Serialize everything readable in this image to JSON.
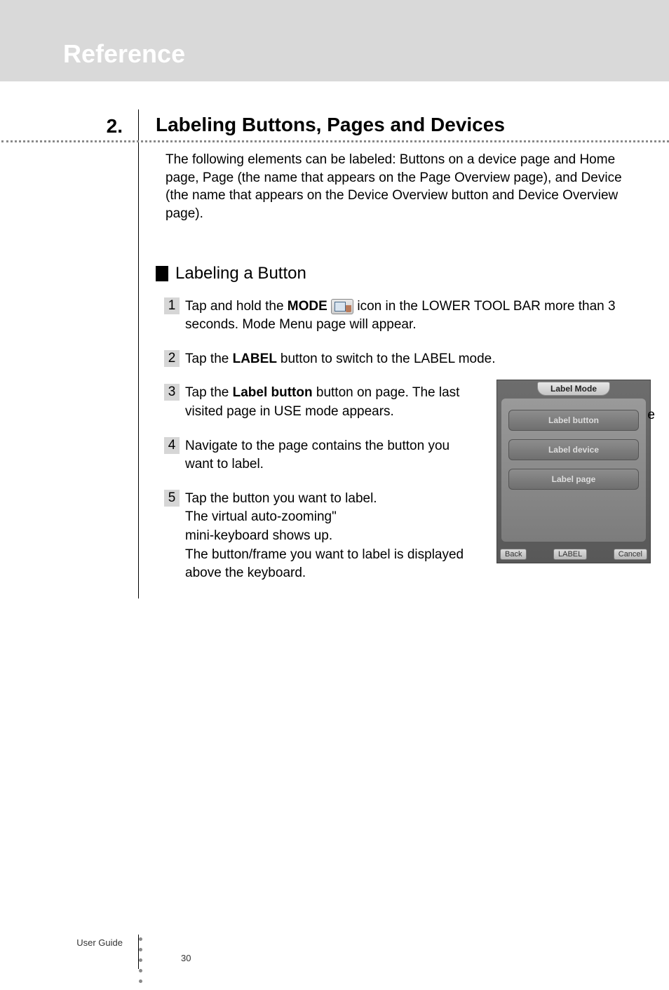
{
  "header": {
    "title": "Reference"
  },
  "section": {
    "number": "2.",
    "heading": "Labeling Buttons, Pages and Devices",
    "intro": "The following elements can be labeled: Buttons on a device page and Home page, Page (the name that appears on the Page Overview page), and Device (the name that appears on the Device Overview button and Device Overview page).",
    "subsection_title": "Labeling a Button",
    "steps": {
      "1": {
        "prefix": "Tap and hold the ",
        "bold": "MODE",
        "suffix": " icon in the LOWER TOOL BAR more than 3 seconds. Mode Menu page will appear."
      },
      "2": {
        "prefix": "Tap the ",
        "bold": " LABEL ",
        "suffix": " button to switch to the LABEL mode."
      },
      "3": {
        "prefix": "Tap the ",
        "bold": " Label button ",
        "suffix": " button on page. The last visited page in USE mode appears."
      },
      "4": {
        "text": "Navigate to the page contains the button you want to label."
      },
      "5": {
        "line1": "Tap the button you want to label.",
        "line2a": "The virtual ",
        "line2b": "auto-zooming\"",
        "line3": "mini-keyboard shows up.",
        "line4": "The button/frame you want to label is displayed above the keyboard."
      }
    },
    "trailing_char": "e"
  },
  "screenshot": {
    "tab": "Label Mode",
    "buttons": {
      "b1": "Label button",
      "b2": "Label device",
      "b3": "Label page"
    },
    "bottom": {
      "back": "Back",
      "label": "LABEL",
      "cancel": "Cancel"
    }
  },
  "footer": {
    "label": "User Guide",
    "page_number": "30"
  }
}
